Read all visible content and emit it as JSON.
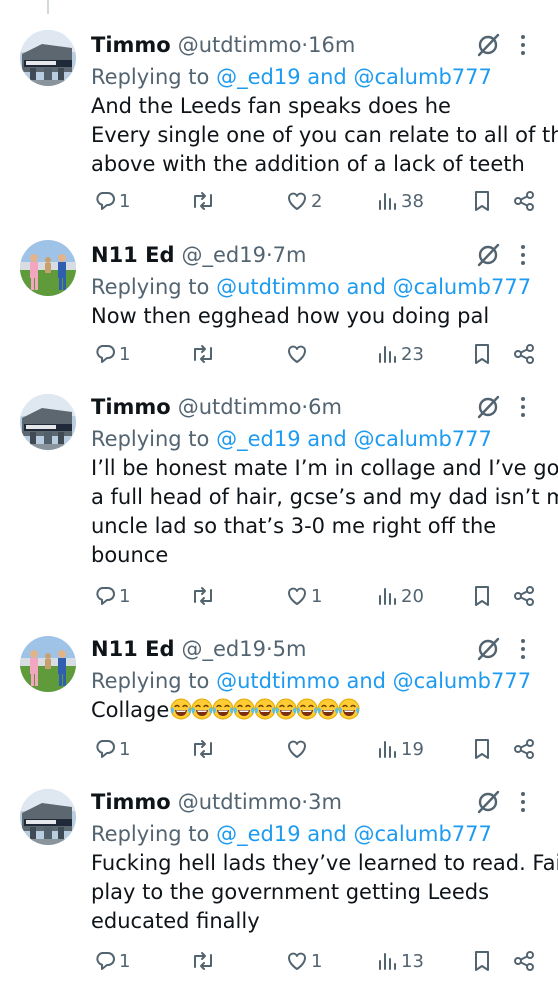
{
  "thread": [
    {
      "name": "Timmo",
      "handle": "@utdtimmo",
      "time": "16m",
      "avatar": "timmo",
      "replying_prefix": "Replying to",
      "mention1": "@_ed19",
      "joiner": " and ",
      "mention2": "@calumb777",
      "lines": [
        "And the Leeds fan speaks does he",
        "Every single one of you can relate to all of the",
        "above with the addition of a lack of teeth"
      ],
      "replies": "1",
      "reposts": "",
      "likes": "2",
      "views": "38"
    },
    {
      "name": "N11 Ed",
      "handle": "@_ed19",
      "time": "7m",
      "avatar": "ed",
      "replying_prefix": "Replying to",
      "mention1": "@utdtimmo",
      "joiner": " and ",
      "mention2": "@calumb777",
      "lines": [
        "Now then egghead how you doing pal"
      ],
      "replies": "1",
      "reposts": "",
      "likes": "",
      "views": "23"
    },
    {
      "name": "Timmo",
      "handle": "@utdtimmo",
      "time": "6m",
      "avatar": "timmo",
      "replying_prefix": "Replying to",
      "mention1": "@_ed19",
      "joiner": " and ",
      "mention2": "@calumb777",
      "lines": [
        "I’ll be honest mate I’m in collage and I’ve got",
        "a full head of hair, gcse’s and my dad isn’t my",
        "uncle lad so that’s 3-0 me right off the",
        "bounce"
      ],
      "replies": "1",
      "reposts": "",
      "likes": "1",
      "views": "20"
    },
    {
      "name": "N11 Ed",
      "handle": "@_ed19",
      "time": "5m",
      "avatar": "ed",
      "replying_prefix": "Replying to",
      "mention1": "@utdtimmo",
      "joiner": " and ",
      "mention2": "@calumb777",
      "lines": [
        "Collage"
      ],
      "emoji_count": 9,
      "emoji": "laughing-tears-emoji",
      "replies": "1",
      "reposts": "",
      "likes": "",
      "views": "19"
    },
    {
      "name": "Timmo",
      "handle": "@utdtimmo",
      "time": "3m",
      "avatar": "timmo",
      "replying_prefix": "Replying to",
      "mention1": "@_ed19",
      "joiner": " and ",
      "mention2": "@calumb777",
      "lines": [
        "Fucking hell lads they’ve learned to read. Fair",
        "play to the government getting Leeds",
        "educated finally"
      ],
      "replies": "1",
      "reposts": "",
      "likes": "1",
      "views": "13"
    }
  ],
  "separator": " · ",
  "icons": [
    "reply-icon",
    "repost-icon",
    "like-icon",
    "views-icon",
    "bookmark-icon",
    "share-icon",
    "grok-icon",
    "more-icon"
  ],
  "colors": {
    "text": "#0f1419",
    "secondary": "#536471",
    "link": "#1d9bf0"
  }
}
